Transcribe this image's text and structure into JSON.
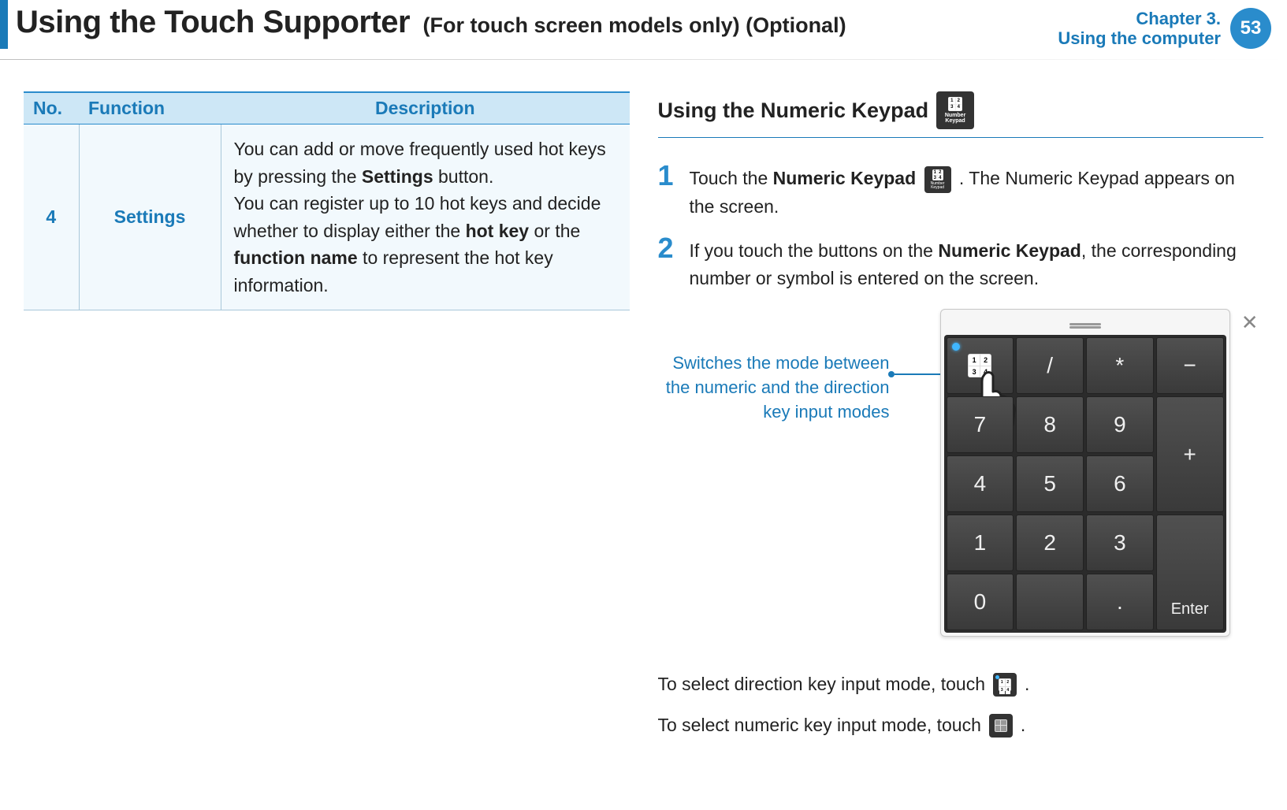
{
  "header": {
    "title": "Using the Touch Supporter",
    "subtitle": "(For touch screen models only) (Optional)",
    "chapter_line1": "Chapter 3.",
    "chapter_line2": "Using the computer",
    "page": "53"
  },
  "table": {
    "headers": {
      "no": "No.",
      "func": "Function",
      "desc": "Description"
    },
    "row": {
      "no": "4",
      "func": "Settings",
      "desc_p1_a": "You can add or move frequently used hot keys by pressing the ",
      "desc_p1_b": "Settings",
      "desc_p1_c": " button.",
      "desc_p2_a": "You can register up to 10 hot keys and decide whether to display either the ",
      "desc_p2_b": "hot key",
      "desc_p2_c": " or the ",
      "desc_p2_d": "function name",
      "desc_p2_e": " to represent the hot key information."
    }
  },
  "right": {
    "section_title": "Using the Numeric Keypad",
    "icon_label": "Number Keypad",
    "step1_a": "Touch the ",
    "step1_b": "Numeric Keypad",
    "step1_c": " . The Numeric Keypad appears on the screen.",
    "step2_a": "If you touch the buttons on the ",
    "step2_b": "Numeric Keypad",
    "step2_c": ", the corresponding number or symbol is entered on the screen.",
    "callout": "Switches the mode between the numeric and the direction key input modes",
    "foot1_a": "To select direction key input mode, touch ",
    "foot1_b": " .",
    "foot2_a": "To select numeric key input mode, touch ",
    "foot2_b": " ."
  },
  "keypad": {
    "keys": {
      "slash": "/",
      "star": "*",
      "minus": "−",
      "k7": "7",
      "k8": "8",
      "k9": "9",
      "plus": "+",
      "k4": "4",
      "k5": "5",
      "k6": "6",
      "k1": "1",
      "k2": "2",
      "k3": "3",
      "enter": "Enter",
      "k0": "0",
      "dot": "."
    },
    "close": "✕"
  }
}
